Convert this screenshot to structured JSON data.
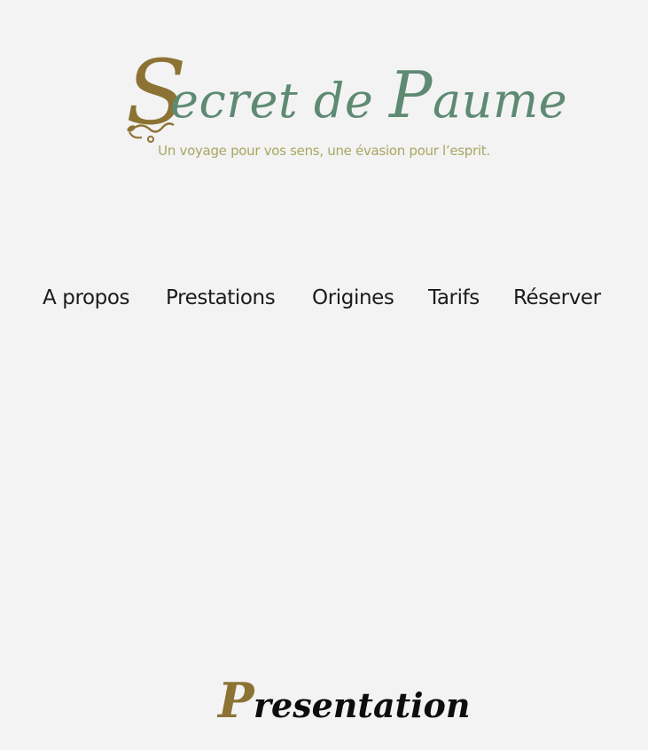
{
  "brand": {
    "logo_initial": "S",
    "logo_rest_a": "ecret de ",
    "logo_cap2": "P",
    "logo_rest_b": "aume",
    "tagline": "Un voyage pour vos sens, une évasion pour l’esprit.",
    "colors": {
      "gold": "#8c7334",
      "green": "#5e8a73",
      "olive": "#a7a762"
    }
  },
  "nav": {
    "items": [
      {
        "label": "A propos"
      },
      {
        "label": "Prestations"
      },
      {
        "label": "Origines"
      },
      {
        "label": "Tarifs"
      },
      {
        "label": "Réserver"
      }
    ]
  },
  "section": {
    "title_initial": "P",
    "title_rest": "resentation"
  },
  "background": "#f3f3f3"
}
